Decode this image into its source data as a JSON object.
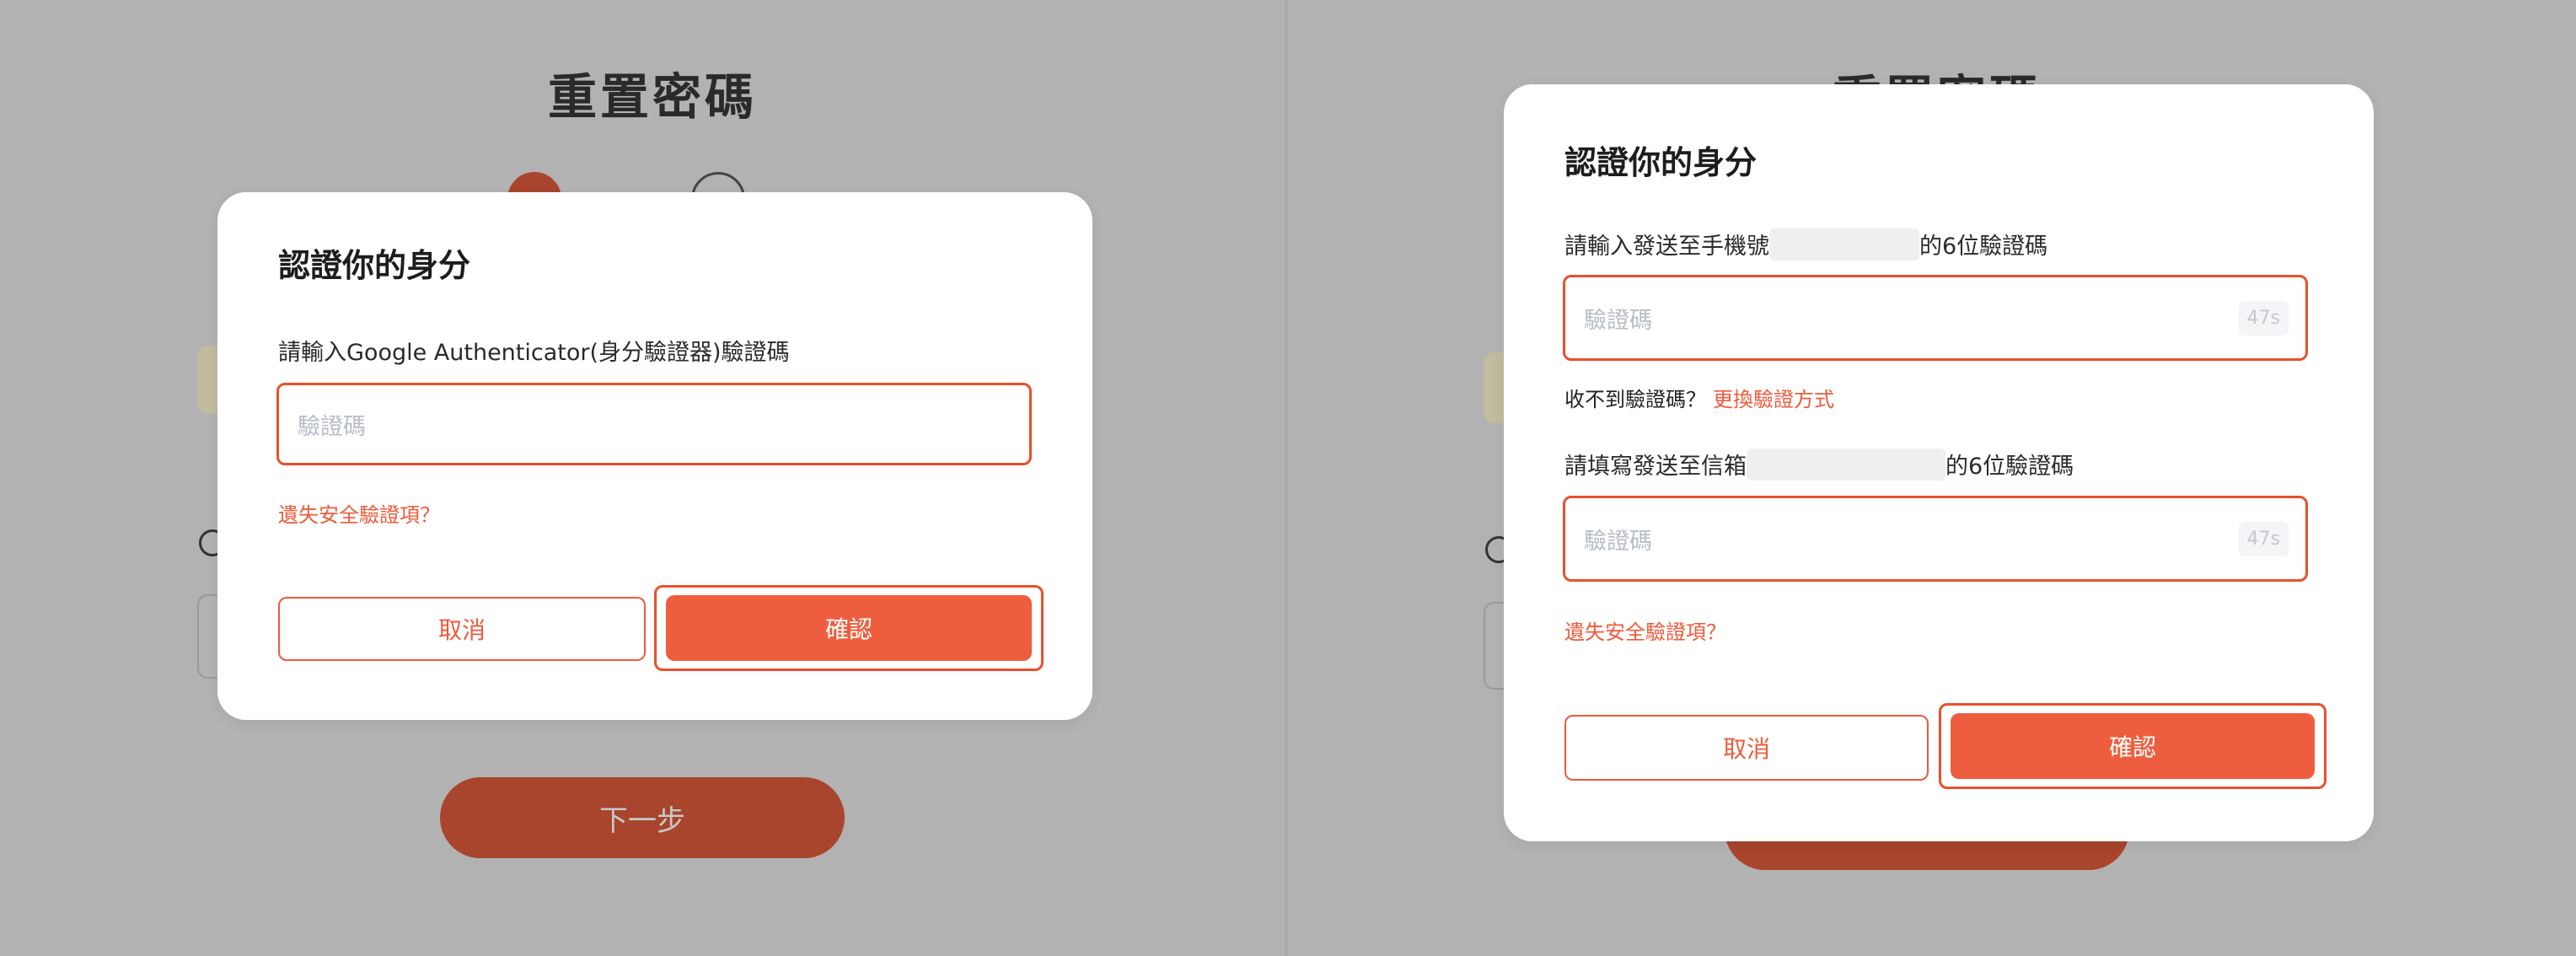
{
  "background": {
    "page_title": "重置密碼",
    "next_button": "下一步"
  },
  "left_modal": {
    "title": "認證你的身分",
    "prompt": "請輸入Google Authenticator(身分驗證器)驗證碼",
    "code_placeholder": "驗證碼",
    "lost_link": "遺失安全驗證項？",
    "cancel_label": "取消",
    "confirm_label": "確認"
  },
  "right_modal": {
    "title": "認證你的身分",
    "phone_prompt_prefix": "請輸入發送至手機號",
    "phone_prompt_suffix": "的6位驗證碼",
    "phone_code_placeholder": "驗證碼",
    "phone_countdown": "47s",
    "not_received_text": "收不到驗證碼？",
    "switch_method_link": "更換驗證方式",
    "email_prompt_prefix": "請填寫發送至信箱",
    "email_prompt_suffix": "的6位驗證碼",
    "email_code_placeholder": "驗證碼",
    "email_countdown": "47s",
    "lost_link": "遺失安全驗證項？",
    "cancel_label": "取消",
    "confirm_label": "確認"
  },
  "colors": {
    "accent": "#ee5e3e",
    "highlight_border": "#e94f2c",
    "overlay_bg": "#b2b2b2"
  }
}
